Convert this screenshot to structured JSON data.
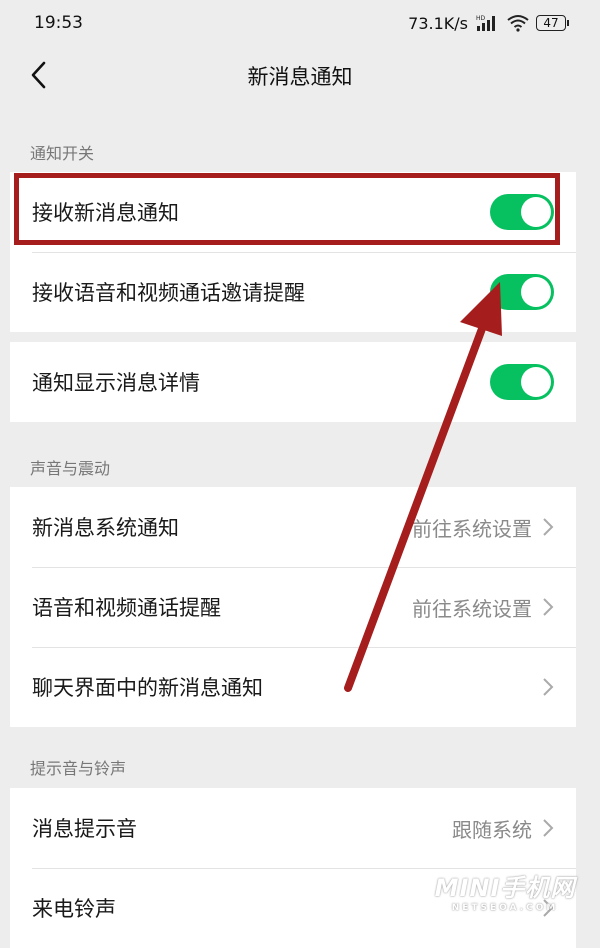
{
  "status_bar": {
    "time": "19:53",
    "network_speed": "73.1K/s",
    "signal_tag": "HD",
    "battery": "47"
  },
  "nav": {
    "title": "新消息通知"
  },
  "sections": {
    "notify_switch": {
      "header": "通知开关",
      "items": [
        {
          "label": "接收新消息通知",
          "toggle_on": true
        },
        {
          "label": "接收语音和视频通话邀请提醒",
          "toggle_on": true
        },
        {
          "label": "通知显示消息详情",
          "toggle_on": true
        }
      ]
    },
    "sound_vibration": {
      "header": "声音与震动",
      "items": [
        {
          "label": "新消息系统通知",
          "value": "前往系统设置"
        },
        {
          "label": "语音和视频通话提醒",
          "value": "前往系统设置"
        },
        {
          "label": "聊天界面中的新消息通知",
          "value": ""
        }
      ]
    },
    "tones": {
      "header": "提示音与铃声",
      "items": [
        {
          "label": "消息提示音",
          "value": "跟随系统"
        },
        {
          "label": "来电铃声",
          "value": ""
        }
      ]
    }
  },
  "watermark": {
    "main": "MINI手机网",
    "sub": "NETSEOA.COM"
  },
  "colors": {
    "toggle_on": "#07c160",
    "annotation_red": "#a51d1d",
    "background": "#ededed"
  }
}
